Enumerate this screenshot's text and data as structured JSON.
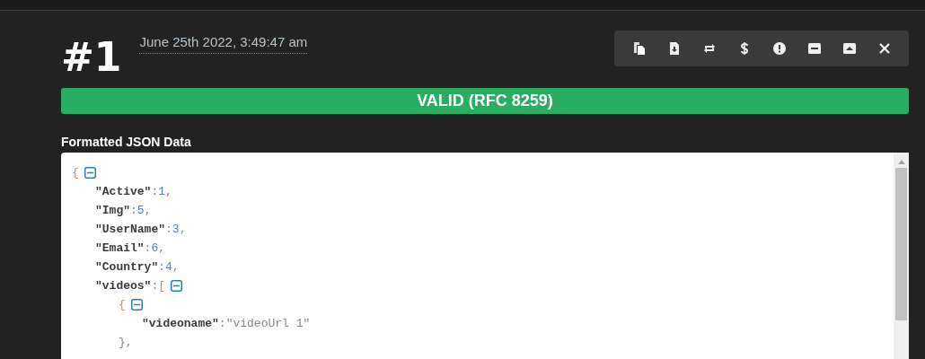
{
  "entry": {
    "number": "#1",
    "timestamp": "June 25th 2022, 3:49:47 am"
  },
  "toolbar": [
    {
      "kind": "copy"
    },
    {
      "kind": "download"
    },
    {
      "kind": "repeat"
    },
    {
      "kind": "dollar"
    },
    {
      "kind": "alert"
    },
    {
      "kind": "minus"
    },
    {
      "kind": "caret-up"
    },
    {
      "kind": "close"
    }
  ],
  "status": {
    "text": "VALID (RFC 8259)",
    "valid": true
  },
  "section_title": "Formatted JSON Data",
  "json_view": {
    "open": "{",
    "expanded": true,
    "children": [
      {
        "key": "\"Active\"",
        "sep": ":",
        "value": "1",
        "kind": "number",
        "trail": ","
      },
      {
        "key": "\"Img\"",
        "sep": ":",
        "value": "5",
        "kind": "number",
        "trail": ","
      },
      {
        "key": "\"UserName\"",
        "sep": ":",
        "value": "3",
        "kind": "number",
        "trail": ","
      },
      {
        "key": "\"Email\"",
        "sep": ":",
        "value": "6",
        "kind": "number",
        "trail": ","
      },
      {
        "key": "\"Country\"",
        "sep": ":",
        "value": "4",
        "kind": "number",
        "trail": ","
      },
      {
        "key": "\"videos\"",
        "sep": ":",
        "open": "[",
        "expanded": true,
        "children": [
          {
            "open": "{",
            "expanded": true,
            "children": [
              {
                "key": "\"videoname\"",
                "sep": ":",
                "value": "\"videoUrl 1\"",
                "kind": "string"
              }
            ],
            "close": "},"
          }
        ]
      }
    ]
  }
}
